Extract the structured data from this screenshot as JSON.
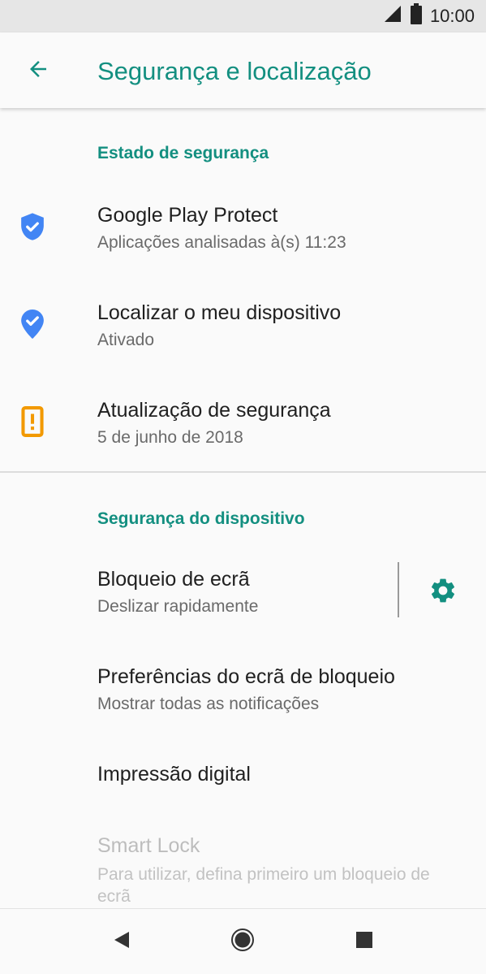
{
  "status_bar": {
    "time": "10:00"
  },
  "app_bar": {
    "title": "Segurança e localização"
  },
  "sections": {
    "security_status": "Estado de segurança",
    "device_security": "Segurança do dispositivo"
  },
  "items": {
    "play_protect": {
      "title": "Google Play Protect",
      "subtitle": "Aplicações analisadas à(s) 11:23"
    },
    "find_device": {
      "title": "Localizar o meu dispositivo",
      "subtitle": "Ativado"
    },
    "security_update": {
      "title": "Atualização de segurança",
      "subtitle": "5 de junho de 2018"
    },
    "screen_lock": {
      "title": "Bloqueio de ecrã",
      "subtitle": "Deslizar rapidamente"
    },
    "lock_screen_prefs": {
      "title": "Preferências do ecrã de bloqueio",
      "subtitle": "Mostrar todas as notificações"
    },
    "fingerprint": {
      "title": "Impressão digital"
    },
    "smart_lock": {
      "title": "Smart Lock",
      "subtitle": "Para utilizar, defina primeiro um bloqueio de ecrã"
    }
  },
  "icons": {
    "back": "arrow-left-icon",
    "shield": "shield-check-icon",
    "location": "location-check-icon",
    "warning": "alert-box-icon",
    "gear": "gear-icon",
    "signal": "signal-icon",
    "battery": "battery-icon",
    "nav_back": "triangle-back-icon",
    "nav_home": "circle-home-icon",
    "nav_recent": "square-recent-icon"
  },
  "colors": {
    "accent": "#138f80",
    "shield_blue": "#4285f4",
    "warning_orange": "#f29900"
  }
}
